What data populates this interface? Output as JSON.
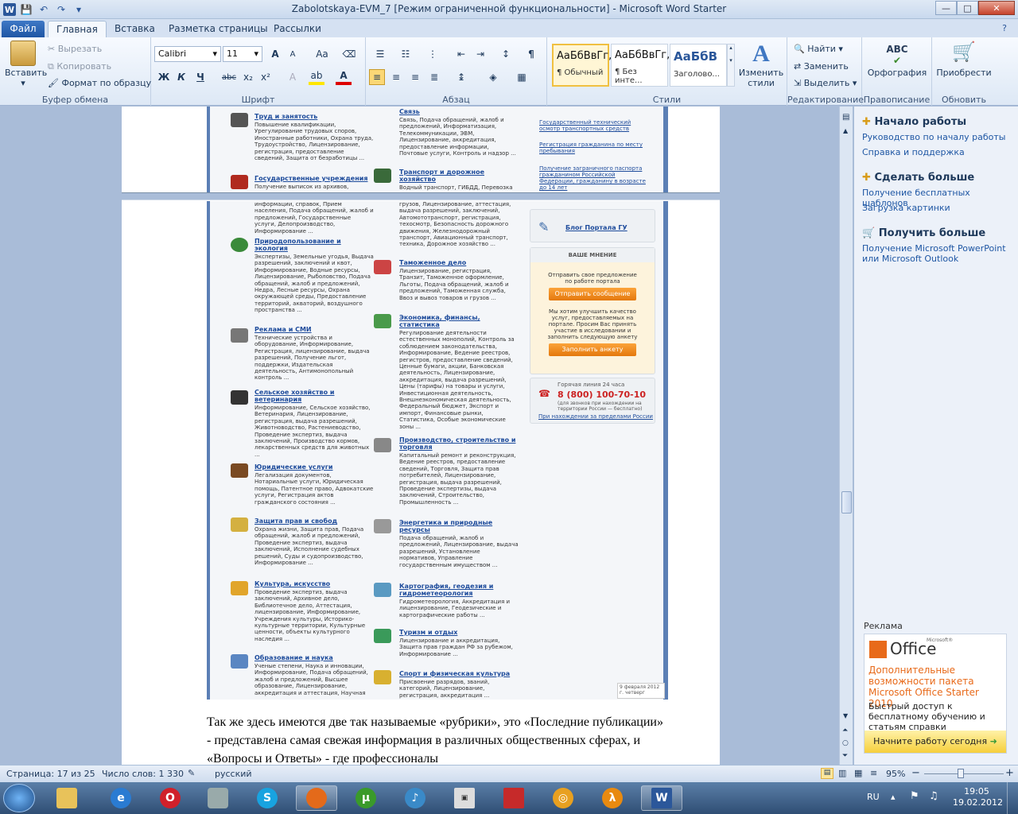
{
  "window": {
    "title": "Zabolotskaya-EVM_7 [Режим ограниченной функциональности]  -  Microsoft Word Starter",
    "minimize": "—",
    "maximize": "□",
    "close": "✕"
  },
  "qat": {
    "app_icon": "W",
    "save": "💾",
    "undo": "↶",
    "redo": "↷",
    "more": "▾"
  },
  "tabs": [
    "Файл",
    "Главная",
    "Вставка",
    "Разметка страницы",
    "Рассылки"
  ],
  "ribbon": {
    "clipboard": {
      "label": "Буфер обмена",
      "paste": "Вставить",
      "cut": "Вырезать",
      "copy": "Копировать",
      "format_painter": "Формат по образцу"
    },
    "font": {
      "label": "Шрифт",
      "name": "Calibri",
      "size": "11",
      "grow": "A",
      "shrink": "A",
      "clear": "Aa",
      "bold": "Ж",
      "italic": "К",
      "underline": "Ч",
      "strike": "abc",
      "sub": "x₂",
      "sup": "x²"
    },
    "paragraph": {
      "label": "Абзац",
      "pilcrow": "¶"
    },
    "styles": {
      "label": "Стили",
      "items": [
        {
          "preview": "АаБбВвГг,",
          "name": "¶ Обычный"
        },
        {
          "preview": "АаБбВвГг,",
          "name": "¶ Без инте..."
        },
        {
          "preview": "АаБбВ",
          "name": "Заголово..."
        }
      ],
      "change": "Изменить стили"
    },
    "editing": {
      "label": "Редактирование",
      "find": "Найти",
      "replace": "Заменить",
      "select": "Выделить"
    },
    "proofing": {
      "label": "Правописание",
      "spelling": "Орфография",
      "abc": "ABC"
    },
    "upgrade": {
      "label": "Обновить",
      "buy": "Приобрести"
    }
  },
  "doc": {
    "top_cats": [
      {
        "title": "Труд и занятость",
        "text": "Повышение квалификации, Урегулирование трудовых споров, Иностранные работники, Охрана труда, Трудоустройство, Лицензирование, регистрация, предоставление сведений, Защита от безработицы ..."
      },
      {
        "title": "Государственные учреждения",
        "text": "Получение выписок из архивов,"
      },
      {
        "title": "Связь",
        "text": "Связь, Подача обращений, жалоб и предложений, Информатизация, Телекоммуникации, ЭВМ, Лицензирование, аккредитация, предоставление информации, Почтовые услуги, Контроль и надзор ..."
      },
      {
        "title": "Транспорт и дорожное хозяйство",
        "text": "Водный транспорт, ГИБДД, Перевозка"
      }
    ],
    "top_links": [
      "Государственный технический осмотр транспортных средств",
      "Регистрация гражданина по месту пребывания",
      "Получение заграничного паспорта гражданином Российской Федерации, гражданину в возрасте до 14 лет"
    ],
    "left_cats": [
      {
        "title": "",
        "text": "информации, справок, Прием населения, Подача обращений, жалоб и предложений, Государственные услуги, Делопроизводство, Информирование ..."
      },
      {
        "title": "Природопользование и экология",
        "text": "Экспертизы, Земельные угодья, Выдача разрешений, заключений и квот, Информирование, Водные ресурсы, Лицензирование, Рыболовство, Подача обращений, жалоб и предложений, Недра, Лесные ресурсы, Охрана окружающей среды, Предоставление территорий, акваторий, воздушного пространства ..."
      },
      {
        "title": "Реклама и СМИ",
        "text": "Технические устройства и оборудование, Информирование, Регистрация, лицензирование, выдача разрешений, Получение льгот, поддержки, Издательская деятельность, Антимонопольный контроль ..."
      },
      {
        "title": "Сельское хозяйство и ветеринария",
        "text": "Информирование, Сельское хозяйство, Ветеринария, Лицензирование, регистрация, выдача разрешений, Животноводство, Растениеводство, Проведение экспертиз, выдача заключений, Производство кормов, лекарственных средств для животных ..."
      },
      {
        "title": "Юридические услуги",
        "text": "Легализация документов, Нотариальные услуги, Юридическая помощь, Патентное право, Адвокатские услуги, Регистрация актов гражданского состояния ..."
      },
      {
        "title": "Защита прав и свобод",
        "text": "Охрана жизни, Защита прав, Подача обращений, жалоб и предложений, Проведение экспертиз, выдача заключений, Исполнение судебных решений, Суды и судопроизводство, Информирование ..."
      },
      {
        "title": "Культура, искусство",
        "text": "Проведение экспертиз, выдача заключений, Архивное дело, Библиотечное дело, Аттестация, лицензирование, Информирование, Учреждения культуры, Историко-культурные территории, Культурные ценности, объекты культурного наследия ..."
      },
      {
        "title": "Образование и наука",
        "text": "Ученые степени, Наука и инновации, Информирование, Подача обращений, жалоб и предложений, Высшее образование, Лицензирование, аккредитация и аттестация, Научная"
      }
    ],
    "mid_cats": [
      {
        "title": "",
        "text": "грузов, Лицензирование, аттестация, выдача разрешений, заключений, Автомототранспорт, регистрация, техосмотр, Безопасность дорожного движения, Железнодорожный транспорт, Авиационный транспорт, техника, Дорожное хозяйство ..."
      },
      {
        "title": "Таможенное дело",
        "text": "Лицензирование, регистрация, Транзит, Таможенное оформление, Льготы, Подача обращений, жалоб и предложений, Таможенная служба, Ввоз и вывоз товаров и грузов ..."
      },
      {
        "title": "Экономика, финансы, статистика",
        "text": "Регулирование деятельности естественных монополий, Контроль за соблюдением законодательства, Информирование, Ведение реестров, регистров, предоставление сведений, Ценные бумаги, акции, Банковская деятельность, Лицензирование, аккредитация, выдача разрешений, Цены (тарифы) на товары и услуги, Инвестиционная деятельность, Внешнеэкономическая деятельность, Федеральный бюджет, Экспорт и импорт, Финансовые рынки, Статистика, Особые экономические зоны ..."
      },
      {
        "title": "Производство, строительство и торговля",
        "text": "Капитальный ремонт и реконструкция, Ведение реестров, предоставление сведений, Торговля, Защита прав потребителей, Лицензирование, регистрация, выдача разрешений, Проведение экспертизы, выдача заключений, Строительство, Промышленность ..."
      },
      {
        "title": "Энергетика и природные ресурсы",
        "text": "Подача обращений, жалоб и предложений, Лицензирование, выдача разрешений, Установление нормативов, Управление государственным имуществом ..."
      },
      {
        "title": "Картография, геодезия и гидрометеорология",
        "text": "Гидрометеорология, Аккредитация и лицензирование, Геодезические и картографические работы ..."
      },
      {
        "title": "Туризм и отдых",
        "text": "Лицензирование и аккредитация, Защита прав граждан РФ за рубежом, Информирование ..."
      },
      {
        "title": "Спорт и физическая культура",
        "text": "Присвоение разрядов, званий, категорий, Лицензирование, регистрация, аккредитация ..."
      }
    ],
    "blog": "Блог Портала ГУ",
    "opinion": {
      "header": "ВАШЕ МНЕНИЕ",
      "text1": "Отправить свое предложение по работе портала",
      "btn1": "Отправить сообщение",
      "text2": "Мы хотим улучшить качество услуг, предоставляемых на портале. Просим Вас принять участие в исследовании и заполнить следующую анкету",
      "btn2": "Заполнить анкету"
    },
    "hotline": {
      "title": "Горячая линия 24 часа",
      "phone": "8 (800) 100-70-10",
      "note": "(для звонков при нахождении на территории России — бесплатно)",
      "abroad": "При нахождении за пределами России"
    },
    "date": "9 февраля 2012 г. четверг",
    "body": "Так же здесь имеются  две так называемые «рубрики», это «Последние публикации» - представлена самая свежая информация в различных общественных сферах, и  «Вопросы и Ответы» - где профессионалы"
  },
  "taskpane": {
    "h1": "Начало работы",
    "l1": [
      "Руководство по началу работы",
      "Справка и поддержка"
    ],
    "h2": "Сделать больше",
    "l2": [
      "Получение бесплатных шаблонов",
      "Загрузка картинки"
    ],
    "h3": "Получить больше",
    "l3": [
      "Получение Microsoft PowerPoint или Microsoft Outlook"
    ],
    "ad_label": "Реклама",
    "ad": {
      "brand": "Office",
      "ms": "Microsoft®",
      "title": "Дополнительные возможности пакета Microsoft Office Starter 2010",
      "text": "Быстрый доступ к бесплатному обучению и статьям справки",
      "cta": "Начните работу сегодня"
    }
  },
  "status": {
    "page": "Страница: 17 из 25",
    "words": "Число слов: 1 330",
    "lang": "русский",
    "zoom": "95%",
    "minus": "−",
    "plus": "+"
  },
  "taskbar": {
    "lang": "RU",
    "time": "19:05",
    "date": "19.02.2012"
  }
}
